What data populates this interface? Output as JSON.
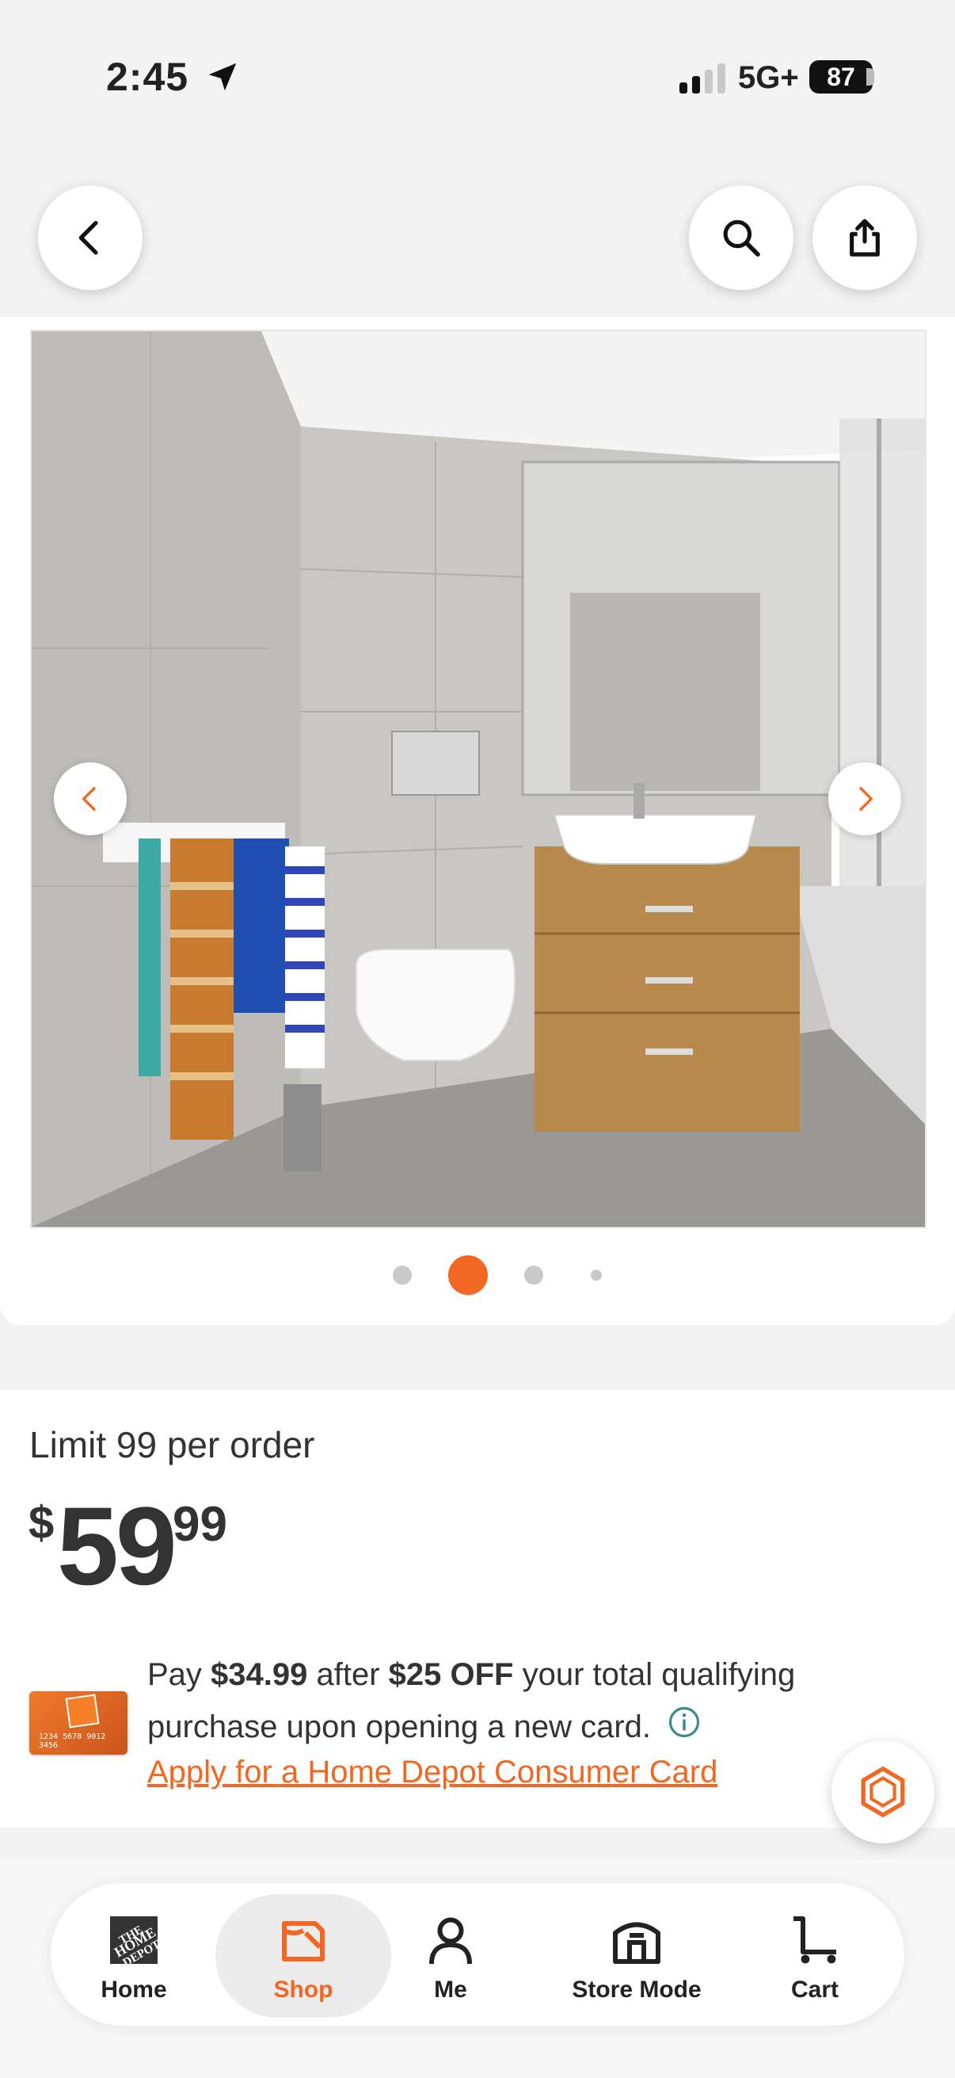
{
  "status_bar": {
    "time": "2:45",
    "network": "5G+",
    "battery": "87"
  },
  "toolbar": {
    "back_icon": "chevron-left-icon",
    "search_icon": "search-icon",
    "share_icon": "share-icon"
  },
  "gallery": {
    "image_description_icon": "bathroom-product-photo",
    "dots_count": 4,
    "active_index": 1
  },
  "product": {
    "limit_text": "Limit 99 per order",
    "price_currency": "$",
    "price_dollars": "59",
    "price_cents": "99"
  },
  "promo": {
    "text_prefix": "Pay ",
    "amount": "$34.99",
    "text_middle": " after ",
    "discount": "$25 OFF",
    "text_suffix": " your total qualifying purchase upon opening a new card.",
    "link_text": "Apply for a Home Depot Consumer Card",
    "card_number": "1234 5678 9012 3456"
  },
  "bottom_nav": {
    "items": [
      {
        "label": "Home",
        "icon": "home-depot-logo-icon"
      },
      {
        "label": "Shop",
        "icon": "shop-icon"
      },
      {
        "label": "Me",
        "icon": "person-icon"
      },
      {
        "label": "Store Mode",
        "icon": "store-icon"
      },
      {
        "label": "Cart",
        "icon": "cart-icon"
      }
    ],
    "active": "Shop"
  },
  "colors": {
    "accent": "#f26722",
    "background": "#f3f3f3"
  }
}
